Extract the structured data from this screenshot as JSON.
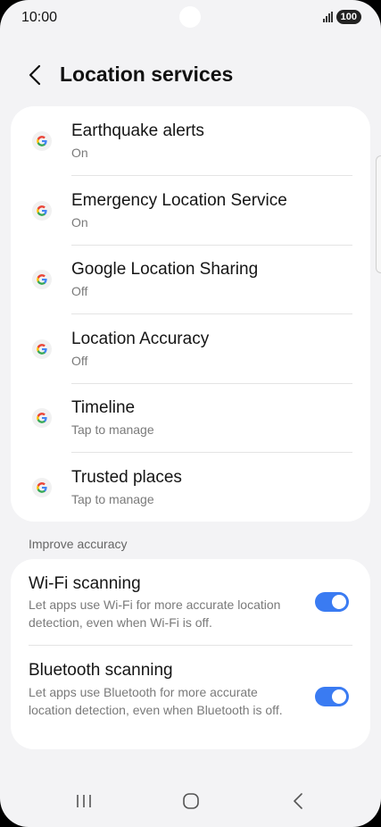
{
  "status_bar": {
    "time": "10:00",
    "battery": "100"
  },
  "header": {
    "title": "Location services"
  },
  "services": [
    {
      "title": "Earthquake alerts",
      "subtitle": "On",
      "icon": "google-g-icon"
    },
    {
      "title": "Emergency Location Service",
      "subtitle": "On",
      "icon": "google-g-icon"
    },
    {
      "title": "Google Location Sharing",
      "subtitle": "Off",
      "icon": "google-g-icon"
    },
    {
      "title": "Location Accuracy",
      "subtitle": "Off",
      "icon": "google-g-icon"
    },
    {
      "title": "Timeline",
      "subtitle": "Tap to manage",
      "icon": "google-g-icon"
    },
    {
      "title": "Trusted places",
      "subtitle": "Tap to manage",
      "icon": "google-g-icon"
    }
  ],
  "improve_accuracy": {
    "label": "Improve accuracy",
    "items": [
      {
        "title": "Wi-Fi scanning",
        "description": "Let apps use Wi-Fi for more accurate location detection, even when Wi-Fi is off.",
        "enabled": true
      },
      {
        "title": "Bluetooth scanning",
        "description": "Let apps use Bluetooth for more accurate location detection, even when Bluetooth is off.",
        "enabled": true
      }
    ]
  },
  "colors": {
    "accent": "#3a7bf2",
    "background": "#f3f3f5",
    "card": "#ffffff"
  }
}
